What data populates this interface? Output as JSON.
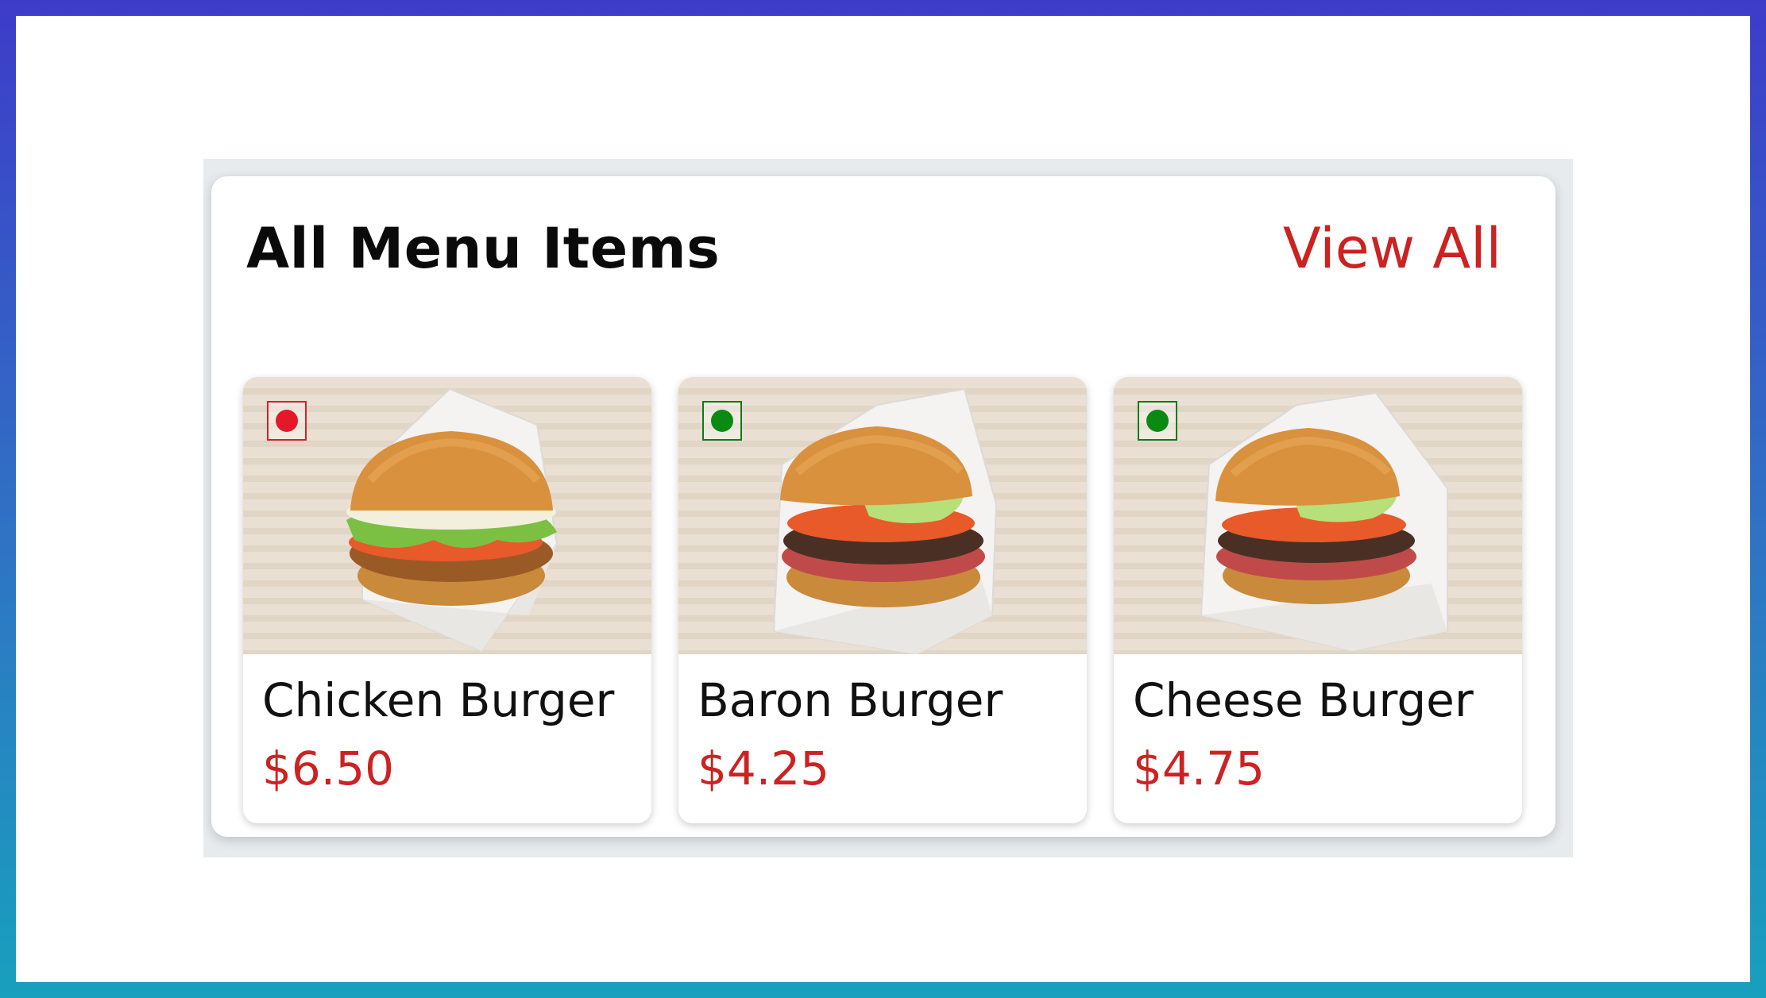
{
  "header": {
    "title": "All Menu Items",
    "view_all_label": "View All"
  },
  "items": [
    {
      "name": "Chicken Burger",
      "price": "$6.50",
      "diet": "non-veg",
      "image": "chicken-burger-photo",
      "marker_icon": "non-veg-marker-icon"
    },
    {
      "name": "Baron Burger",
      "price": "$4.25",
      "diet": "veg",
      "image": "baron-burger-photo",
      "marker_icon": "veg-marker-icon"
    },
    {
      "name": "Cheese Burger",
      "price": "$4.75",
      "diet": "veg",
      "image": "cheese-burger-photo",
      "marker_icon": "veg-marker-icon"
    }
  ],
  "colors": {
    "accent": "#cc2222",
    "veg_marker": "#0a8a12",
    "non_veg_marker": "#e5182a",
    "title_text": "#0a0a0a"
  }
}
